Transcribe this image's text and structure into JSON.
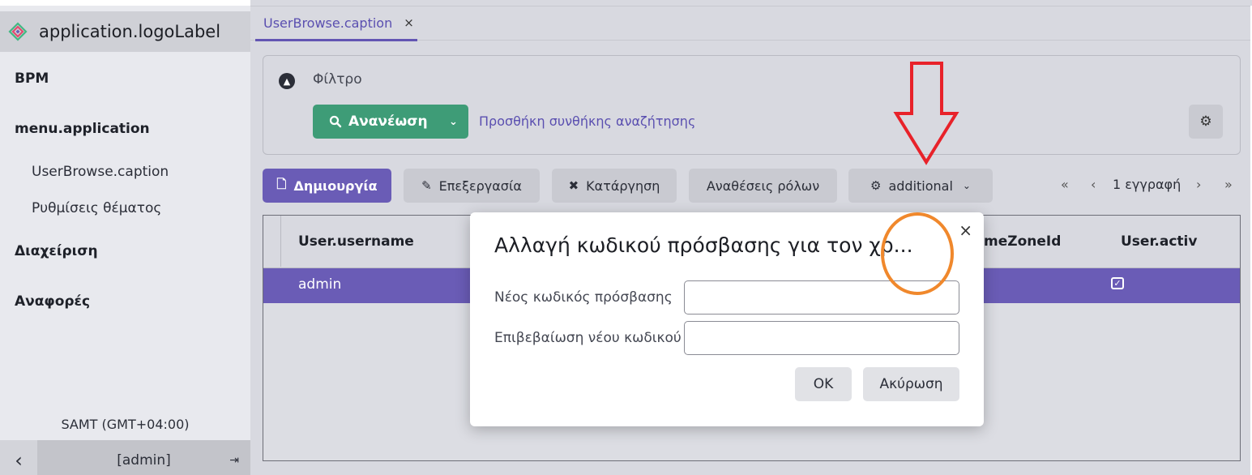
{
  "app": {
    "logo_label": "application.logoLabel"
  },
  "sidebar": {
    "items": [
      {
        "label": "BPM"
      },
      {
        "label": "menu.application"
      },
      {
        "label": "UserBrowse.caption"
      },
      {
        "label": "Ρυθμίσεις θέματος"
      },
      {
        "label": "Διαχείριση"
      },
      {
        "label": "Αναφορές"
      }
    ],
    "timezone": "SAMT (GMT+04:00)",
    "user": "[admin]"
  },
  "tabs": [
    {
      "label": "UserBrowse.caption",
      "close": "×"
    }
  ],
  "filter": {
    "label": "Φίλτρο",
    "refresh_label": "Ανανέωση",
    "add_condition": "Προσθήκη συνθήκης αναζήτησης"
  },
  "toolbar": {
    "create": "Δημιουργία",
    "edit": "Επεξεργασία",
    "remove": "Κατάργηση",
    "role_assignments": "Αναθέσεις ρόλων",
    "additional": "additional"
  },
  "pager": {
    "first": "«",
    "prev": "‹",
    "count": "1 εγγραφή",
    "next": "›",
    "last": "»"
  },
  "table": {
    "columns": [
      "User.username",
      "meZoneId",
      "User.activ"
    ],
    "rows": [
      {
        "username": "admin",
        "active": true
      }
    ]
  },
  "dialog": {
    "title": "Αλλαγή κωδικού πρόσβασης για τον χρ...",
    "close": "×",
    "new_password_label": "Νέος κωδικός πρόσβασης",
    "new_password_value": "",
    "confirm_label": "Επιβεβαίωση νέου κωδικού",
    "confirm_value": "",
    "ok": "OK",
    "cancel": "Ακύρωση"
  },
  "colors": {
    "accent": "#6a5cb6",
    "refresh": "#3e9c77",
    "arrow": "#e8222a",
    "circle": "#f0882c"
  },
  "icons": {
    "logo": "jmix-logo-icon",
    "filter_toggle": "chevron-up-circle-icon",
    "search": "search-icon",
    "settings": "gear-icon",
    "create": "file-icon",
    "edit": "pencil-icon",
    "remove": "x-icon",
    "additional": "cogs-icon",
    "check": "checkbox-checked-icon",
    "logout": "sign-out-icon"
  }
}
